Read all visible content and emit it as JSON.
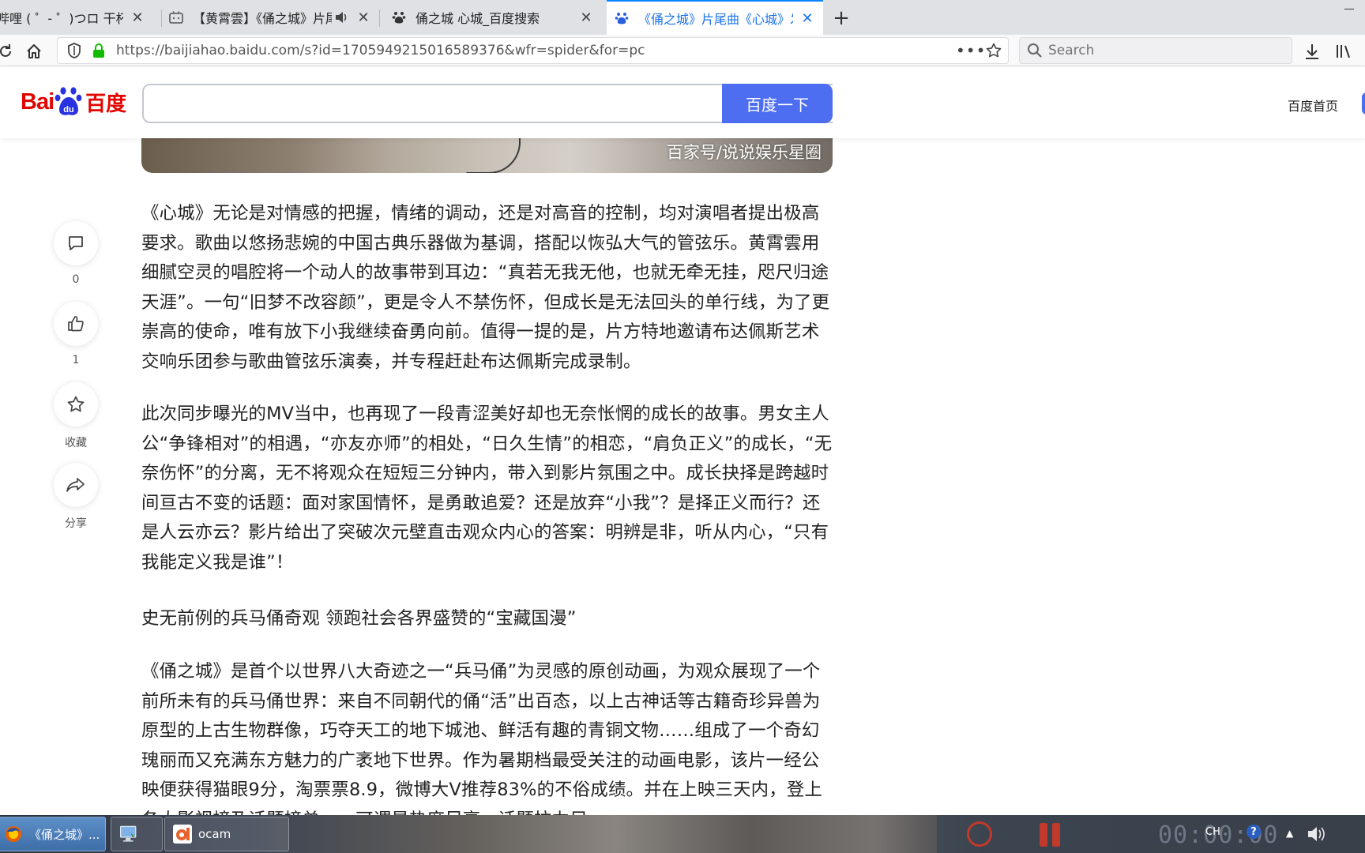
{
  "tabs": [
    {
      "title": "哔哩 ( ゜- ゜)つロ 干杯~-bi",
      "active": false
    },
    {
      "title": "【黄霄雲】《俑之城》片尾",
      "active": false
    },
    {
      "title": "俑之城 心城_百度搜索",
      "active": false
    },
    {
      "title": "《俑之城》片尾曲《心城》发布",
      "active": true
    }
  ],
  "toolbar": {
    "url": "https://baijiahao.baidu.com/s?id=1705949215016589376&wfr=spider&for=pc",
    "search_placeholder": "Search",
    "more": "•••"
  },
  "header": {
    "logo_bai": "Bai",
    "logo_du": "百度",
    "search_button": "百度一下",
    "search_value": "",
    "home_link": "百度首页"
  },
  "article": {
    "image_watermark": "百家号/说说娱乐星圈",
    "paragraphs": [
      "《心城》无论是对情感的把握，情绪的调动，还是对高音的控制，均对演唱者提出极高要求。歌曲以悠扬悲婉的中国古典乐器做为基调，搭配以恢弘大气的管弦乐。黄霄雲用细腻空灵的唱腔将一个动人的故事带到耳边：“真若无我无他，也就无牵无挂，咫尺归途天涯”。一句“旧梦不改容颜”，更是令人不禁伤怀，但成长是无法回头的单行线，为了更崇高的使命，唯有放下小我继续奋勇向前。值得一提的是，片方特地邀请布达佩斯艺术交响乐团参与歌曲管弦乐演奏，并专程赶赴布达佩斯完成录制。",
      "此次同步曝光的MV当中，也再现了一段青涩美好却也无奈怅惘的成长的故事。男女主人公“争锋相对”的相遇，“亦友亦师”的相处，“日久生情”的相恋，“肩负正义”的成长，“无奈伤怀”的分离，无不将观众在短短三分钟内，带入到影片氛围之中。成长抉择是跨越时间亘古不变的话题：面对家国情怀，是勇敢追爱？还是放弃“小我”？是择正义而行？还是人云亦云？影片给出了突破次元壁直击观众内心的答案：明辨是非，听从内心，“只有我能定义我是谁”！",
      "史无前例的兵马俑奇观 领跑社会各界盛赞的“宝藏国漫”",
      "《俑之城》是首个以世界八大奇迹之一“兵马俑”为灵感的原创动画，为观众展现了一个前所未有的兵马俑世界：来自不同朝代的俑“活”出百态，以上古神话等古籍奇珍异兽为原型的上古生物群像，巧夺天工的地下城池、鲜活有趣的青铜文物……组成了一个奇幻瑰丽而又充满东方魅力的广袤地下世界。作为暑期档最受关注的动画电影，该片一经公映便获得猫眼9分，淘票票8.9，微博大V推荐83%的不俗成绩。并在上映三天内，登上各大影视榜及话题榜单……可谓是热度尽享，话题拉力足"
    ]
  },
  "rail": {
    "comment_count": "0",
    "like_count": "1",
    "favorite_label": "收藏",
    "share_label": "分享"
  },
  "taskbar": {
    "items": [
      {
        "label": "《俑之城》...",
        "active": true
      },
      {
        "label": "",
        "active": false
      },
      {
        "label": "ocam",
        "active": false
      }
    ],
    "timer": "00:00:00",
    "lang": "CH"
  },
  "colors": {
    "baidu_blue": "#4e6ef2",
    "baidu_red": "#e10601",
    "active_tab_text": "#1a73e8"
  }
}
